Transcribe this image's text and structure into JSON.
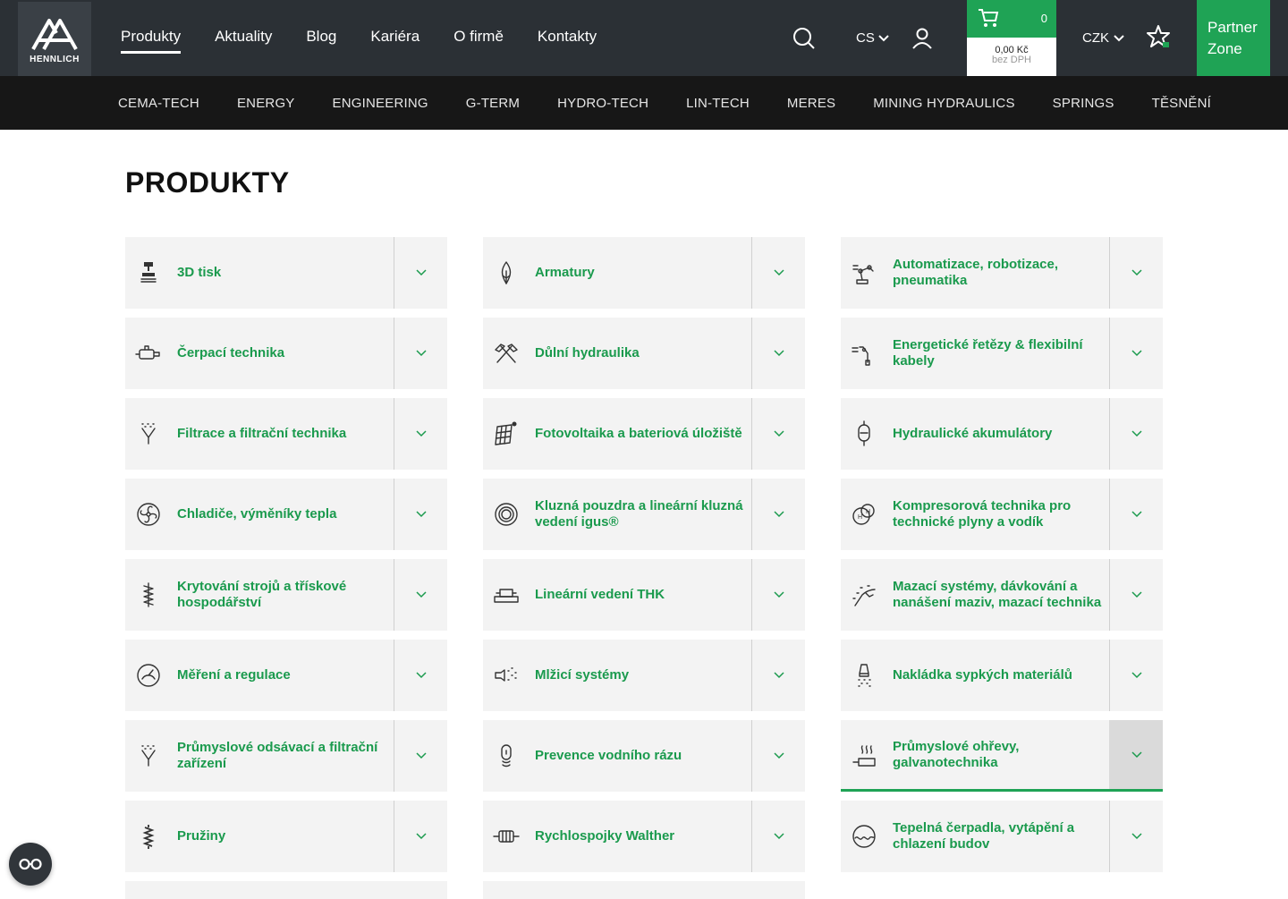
{
  "brand": {
    "logo_text": "HENNLICH"
  },
  "main_nav": [
    {
      "label": "Produkty",
      "active": true
    },
    {
      "label": "Aktuality"
    },
    {
      "label": "Blog"
    },
    {
      "label": "Kariéra"
    },
    {
      "label": "O firmě"
    },
    {
      "label": "Kontakty"
    }
  ],
  "header": {
    "language": "CS",
    "cart_count": "0",
    "cart_price": "0,00 Kč",
    "cart_vat": "bez DPH",
    "currency": "CZK",
    "partner_line1": "Partner",
    "partner_line2": "Zone"
  },
  "sub_nav": [
    "CEMA-TECH",
    "ENERGY",
    "ENGINEERING",
    "G-TERM",
    "HYDRO-TECH",
    "LIN-TECH",
    "MERES",
    "MINING HYDRAULICS",
    "SPRINGS",
    "TĚSNĚNÍ"
  ],
  "page_title": "PRODUKTY",
  "products": [
    {
      "label": "3D tisk",
      "icon": "3d-printer-icon"
    },
    {
      "label": "Armatury",
      "icon": "valve-flame-icon"
    },
    {
      "label": "Automatizace, robotizace, pneumatika",
      "icon": "robot-arm-icon"
    },
    {
      "label": "Čerpací technika",
      "icon": "pump-icon"
    },
    {
      "label": "Důlní hydraulika",
      "icon": "mining-hammers-icon"
    },
    {
      "label": "Energetické řetězy & flexibilní kabely",
      "icon": "cable-chain-icon"
    },
    {
      "label": "Filtrace a filtrační technika",
      "icon": "filter-funnel-icon"
    },
    {
      "label": "Fotovoltaika a bateriová úložiště",
      "icon": "solar-panel-icon"
    },
    {
      "label": "Hydraulické akumulátory",
      "icon": "accumulator-icon"
    },
    {
      "label": "Chladiče, výměníky tepla",
      "icon": "fan-icon"
    },
    {
      "label": "Kluzná pouzdra a lineární kluzná vedení igus®",
      "icon": "bushing-icon"
    },
    {
      "label": "Kompresorová technika pro technické plyny a vodík",
      "icon": "hydrogen-icon"
    },
    {
      "label": "Krytování strojů a třískové hospodářství",
      "icon": "bellows-icon"
    },
    {
      "label": "Lineární vedení THK",
      "icon": "linear-guide-icon"
    },
    {
      "label": "Mazací systémy, dávkování a nanášení maziv, mazací technika",
      "icon": "lubrication-icon"
    },
    {
      "label": "Měření a regulace",
      "icon": "gauge-icon"
    },
    {
      "label": "Mlžicí systémy",
      "icon": "mist-nozzle-icon"
    },
    {
      "label": "Nakládka sypkých materiálů",
      "icon": "loading-spout-icon"
    },
    {
      "label": "Průmyslové odsávací a filtrační zařízení",
      "icon": "extraction-filter-icon"
    },
    {
      "label": "Prevence vodního rázu",
      "icon": "water-hammer-icon"
    },
    {
      "label": "Průmyslové ohřevy, galvanotechnika",
      "icon": "heater-icon",
      "active": true
    },
    {
      "label": "Pružiny",
      "icon": "spring-icon"
    },
    {
      "label": "Rychlospojky Walther",
      "icon": "coupling-icon"
    },
    {
      "label": "Tepelná čerpadla, vytápění a chlazení budov",
      "icon": "heat-pump-icon"
    }
  ],
  "colors": {
    "accent": "#1fa355",
    "topbar": "#2b3035",
    "subnav": "#171717",
    "card_bg": "#f3f3f3"
  }
}
